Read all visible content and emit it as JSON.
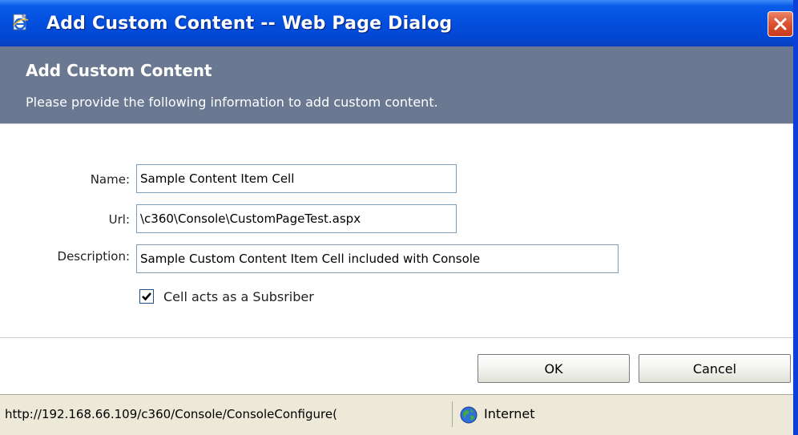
{
  "window": {
    "title": "Add Custom Content -- Web Page Dialog"
  },
  "header": {
    "title": "Add Custom Content",
    "subtitle": "Please provide the following information to add custom content."
  },
  "form": {
    "name_label": "Name:",
    "name_value": "Sample Content Item Cell",
    "url_label": "Url:",
    "url_value": "\\c360\\Console\\CustomPageTest.aspx",
    "description_label": "Description:",
    "description_value": "Sample Custom Content Item Cell included with Console",
    "subscriber_label": "Cell acts as a Subsriber",
    "subscriber_checked": true
  },
  "buttons": {
    "ok_label": "OK",
    "cancel_label": "Cancel"
  },
  "statusbar": {
    "url": "http://192.168.66.109/c360/Console/ConsoleConfigure(",
    "zone": "Internet"
  },
  "icons": {
    "title_icon": "ie-page-icon",
    "close_icon": "close-icon",
    "check_icon": "checkmark-icon",
    "zone_icon": "globe-icon"
  },
  "colors": {
    "titlebar": "#0451e0",
    "header_band": "#6a7891",
    "close_button": "#dd5535",
    "input_border": "#7f9db9"
  }
}
